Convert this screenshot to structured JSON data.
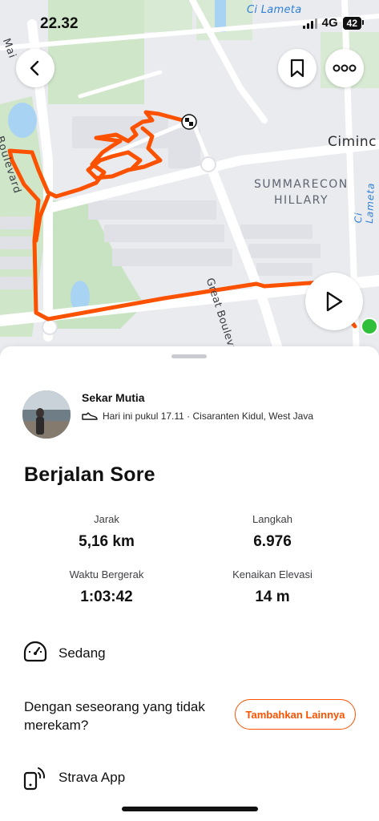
{
  "status_bar": {
    "time": "22.32",
    "network": "4G",
    "battery": "42"
  },
  "map": {
    "labels": {
      "summarecon": "SUMMARECON",
      "hillary": "HILLARY",
      "ciminc": "Ciminc",
      "great_boulevard": "Great Boulevard",
      "boulevard_left": "Boulevard",
      "mai": "Mai",
      "cilameta_top": "Ci Lameta",
      "cilameta_right": "Ci Lameta"
    },
    "route_color": "#fc5200",
    "start_marker_color": "#2fbf3a"
  },
  "buttons": {
    "back_icon": "chevron-left-icon",
    "bookmark_icon": "bookmark-icon",
    "more_icon": "more-horizontal-icon",
    "play_icon": "play-icon"
  },
  "athlete": {
    "name": "Sekar Mutia",
    "meta": "Hari ini pukul 17.11 · Cisaranten Kidul, West Java",
    "meta_icon": "shoe-icon"
  },
  "activity": {
    "title": "Berjalan Sore",
    "stats": [
      {
        "label": "Jarak",
        "value": "5,16 km"
      },
      {
        "label": "Langkah",
        "value": "6.976"
      },
      {
        "label": "Waktu Bergerak",
        "value": "1:03:42"
      },
      {
        "label": "Kenaikan Elevasi",
        "value": "14 m"
      }
    ]
  },
  "effort": {
    "label": "Sedang",
    "icon": "speedometer-icon"
  },
  "with_others": {
    "text": "Dengan seseorang yang tidak merekam?",
    "button": "Tambahkan Lainnya"
  },
  "device": {
    "label": "Strava App",
    "icon": "device-sync-icon"
  },
  "accent_color": "#fc5200"
}
